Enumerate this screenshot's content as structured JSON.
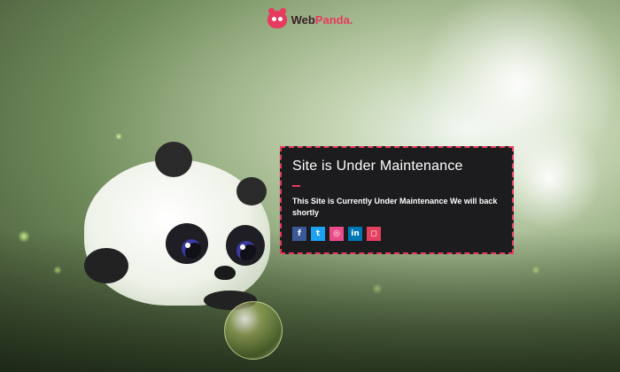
{
  "brand": {
    "name_part1": "Web",
    "name_part2": "Panda.",
    "accent_color": "#e83a5e"
  },
  "maintenance": {
    "title": "Site is Under Maintenance",
    "message": "This Site is Currently Under Maintenance We will back shortly"
  },
  "social": [
    {
      "name": "facebook",
      "icon": "facebook-icon",
      "glyph": "f",
      "color": "#3b5998"
    },
    {
      "name": "twitter",
      "icon": "twitter-icon",
      "glyph": "t",
      "color": "#1da1f2"
    },
    {
      "name": "dribbble",
      "icon": "dribbble-icon",
      "glyph": "◎",
      "color": "#ea4c89"
    },
    {
      "name": "linkedin",
      "icon": "linkedin-icon",
      "glyph": "in",
      "color": "#0077b5"
    },
    {
      "name": "instagram",
      "icon": "instagram-icon",
      "glyph": "◻",
      "color": "#e4405f"
    }
  ]
}
